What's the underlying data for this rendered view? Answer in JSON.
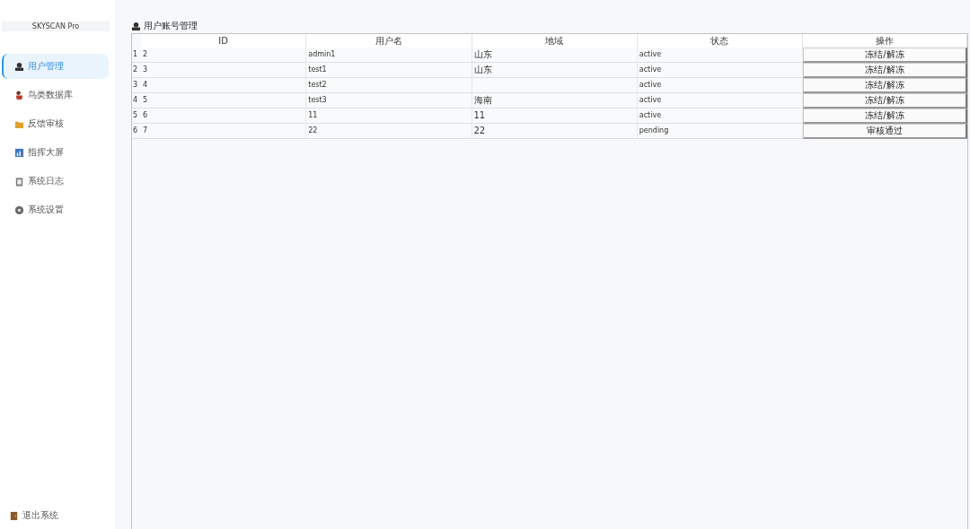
{
  "sidebar": {
    "brand": "SKYSCAN Pro",
    "items": [
      {
        "label": "用户管理",
        "selected": true
      },
      {
        "label": "鸟类数据库",
        "selected": false
      },
      {
        "label": "反馈审核",
        "selected": false
      },
      {
        "label": "指挥大屏",
        "selected": false
      },
      {
        "label": "系统日志",
        "selected": false
      },
      {
        "label": "系统设置",
        "selected": false
      }
    ],
    "footer": {
      "label": "退出系统"
    }
  },
  "page_title": "用户账号管理",
  "table": {
    "columns": [
      "ID",
      "用户名",
      "地域",
      "状态",
      "操作"
    ],
    "rows": [
      {
        "number": "1",
        "id": "2",
        "username": "admin1",
        "region": "山东",
        "status": "active",
        "action": "冻结/解冻"
      },
      {
        "number": "2",
        "id": "3",
        "username": "test1",
        "region": "山东",
        "status": "active",
        "action": "冻结/解冻"
      },
      {
        "number": "3",
        "id": "4",
        "username": "test2",
        "status": "active",
        "action": "冻结/解冻"
      },
      {
        "number": "4",
        "id": "5",
        "username": "test3",
        "region": "海南",
        "status": "active",
        "action": "冻结/解冻"
      },
      {
        "number": "5",
        "id": "6",
        "username": "11",
        "region": "11",
        "status": "active",
        "action": "冻结/解冻"
      },
      {
        "number": "6",
        "id": "7",
        "username": "22",
        "region": "22",
        "status": "pending",
        "action": "审核通过"
      }
    ]
  }
}
